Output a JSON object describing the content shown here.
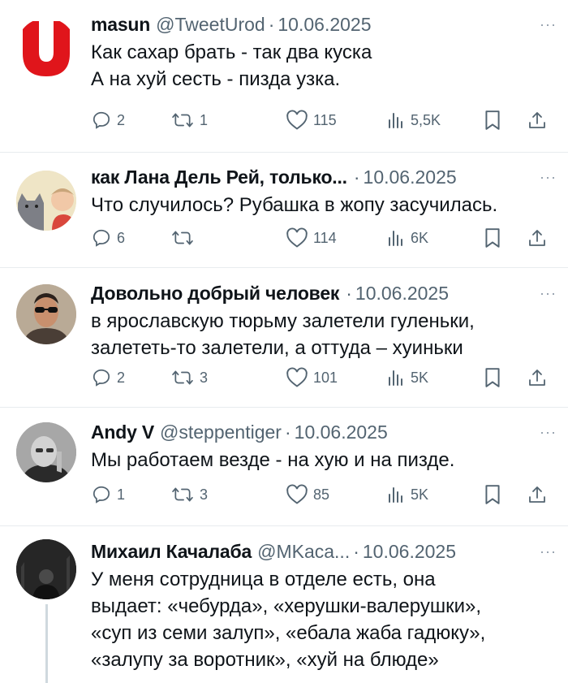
{
  "tweets": [
    {
      "name": "masun",
      "handle": "@TweetUrod",
      "date": "10.06.2025",
      "lines": [
        "Как сахар брать - так два куска",
        "А на хуй сесть - пизда узка."
      ],
      "replies": "2",
      "retweets": "1",
      "likes": "115",
      "views": "5,5K",
      "avatar_letter": "U"
    },
    {
      "name": "как Лана Дель Рей, только...",
      "handle": "",
      "date": "10.06.2025",
      "lines": [
        "Что случилось? Рубашка в жопу засучилась."
      ],
      "replies": "6",
      "retweets": "",
      "likes": "114",
      "views": "6K"
    },
    {
      "name": "Довольно добрый человек",
      "handle": "",
      "date": "10.06.2025",
      "lines": [
        "в ярославскую тюрьму залетели гуленьки,",
        "залететь-то залетели, а оттуда – хуиньки"
      ],
      "replies": "2",
      "retweets": "3",
      "likes": "101",
      "views": "5K"
    },
    {
      "name": "Andy V",
      "handle": "@steppentiger",
      "date": "10.06.2025",
      "lines": [
        "Мы работаем везде - на хую и на пизде."
      ],
      "replies": "1",
      "retweets": "3",
      "likes": "85",
      "views": "5K"
    },
    {
      "name": "Михаил Качалаба",
      "handle": "@MKaca...",
      "date": "10.06.2025",
      "lines": [
        "У меня сотрудница в отделе есть, она",
        "выдает: «чебурда», «херушки-валерушки»,",
        "«суп из семи залуп», «ебала жаба гадюку»,",
        "«залупу за воротник», «хуй на блюде»"
      ]
    }
  ],
  "ui": {
    "dot": "·",
    "more": "···"
  },
  "colors": {
    "brand_red": "#e0151b",
    "meta_gray": "#536471",
    "divider": "#e8ecef"
  }
}
